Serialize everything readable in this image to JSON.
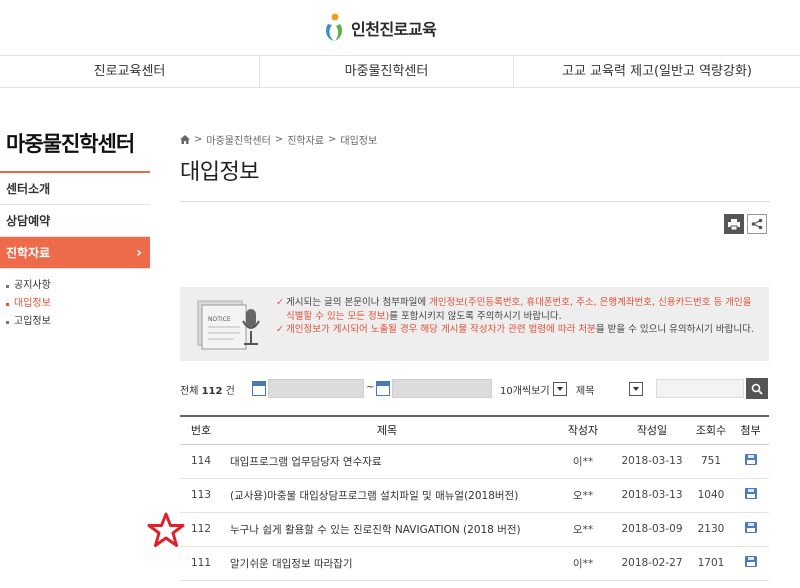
{
  "header": {
    "logo_text": "인천진로교육"
  },
  "gnb": [
    "진로교육센터",
    "마중물진학센터",
    "고교 교육력 제고(일반고 역량강화)"
  ],
  "sidebar": {
    "title": "마중물진학센터",
    "items": [
      {
        "label": "센터소개",
        "active": false
      },
      {
        "label": "상담예약",
        "active": false
      },
      {
        "label": "진학자료",
        "active": true,
        "arrow": "›"
      }
    ],
    "sub_items": [
      {
        "label": "공지사항",
        "active": false
      },
      {
        "label": "대입정보",
        "active": true
      },
      {
        "label": "고입정보",
        "active": false
      }
    ]
  },
  "breadcrumb": [
    "마중물진학센터",
    "진학자료",
    "대입정보"
  ],
  "breadcrumb_sep": ">",
  "page_title": "대입정보",
  "notice": {
    "art_label": "NOTICE",
    "line1_pre": "게시되는 글의 본문이나 첨부파일에 ",
    "line1_red": "개인정보(주민등록번호, 휴대폰번호, 주소, 은행계좌번호, 신용카드번호 등 개인을 식별할 수 있는 모든 정보)",
    "line1_post": "를 포함시키지 않도록 주의하시기 바랍니다.",
    "line2_red": "개인정보가 게시되어 노출될 경우 해당 게시물 작성자가 관련 법령에 따라 처분",
    "line2_post": "을 받을 수 있으니 유의하시기 바랍니다.",
    "check": "✓"
  },
  "search": {
    "total_label": "전체",
    "total_count": "112",
    "total_unit": "건",
    "tilde": "~",
    "per_page": "10개씩보기",
    "field": "제목"
  },
  "table": {
    "headers": [
      "번호",
      "제목",
      "작성자",
      "작성일",
      "조회수",
      "첨부"
    ],
    "rows": [
      {
        "no": "114",
        "subject": "대입프로그램 업무담당자 연수자료",
        "author": "이**",
        "date": "2018-03-13",
        "views": "751"
      },
      {
        "no": "113",
        "subject": "(교사용)마중물 대입상담프로그램 설치파일 및 매뉴얼(2018버전)",
        "author": "오**",
        "date": "2018-03-13",
        "views": "1040"
      },
      {
        "no": "112",
        "subject": "누구나 쉽게 활용할 수 있는 진로진학 NAVIGATION (2018 버전)",
        "author": "오**",
        "date": "2018-03-09",
        "views": "2130"
      },
      {
        "no": "111",
        "subject": "알기쉬운 대입정보 따라잡기",
        "author": "이**",
        "date": "2018-02-27",
        "views": "1701"
      }
    ]
  },
  "colors": {
    "accent": "#ed6a4b",
    "annotation_star": "#e0212a"
  }
}
